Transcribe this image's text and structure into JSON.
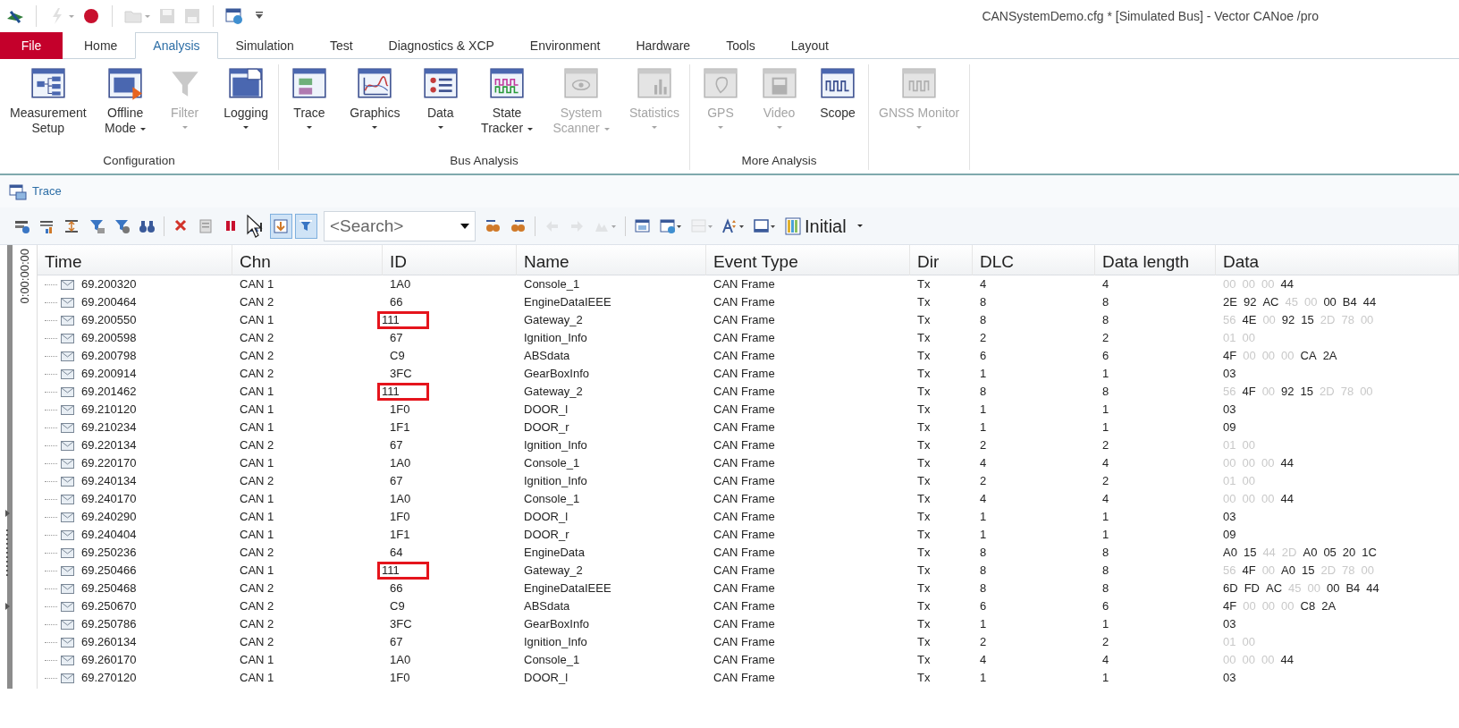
{
  "window": {
    "title": "CANSystemDemo.cfg * [Simulated Bus] - Vector CANoe /pro"
  },
  "quick_access": [
    {
      "kind": "logo",
      "disabled": false
    },
    {
      "kind": "sep"
    },
    {
      "kind": "bolt",
      "disabled": true,
      "dropdown": true
    },
    {
      "kind": "stop",
      "disabled": false
    },
    {
      "kind": "sep"
    },
    {
      "kind": "folder",
      "disabled": true,
      "dropdown": true
    },
    {
      "kind": "save",
      "disabled": true
    },
    {
      "kind": "saveall",
      "disabled": true
    },
    {
      "kind": "sep"
    },
    {
      "kind": "globe",
      "disabled": false
    },
    {
      "kind": "customize",
      "disabled": false
    }
  ],
  "menu_tabs": [
    {
      "label": "File",
      "kind": "file",
      "selected": false
    },
    {
      "label": "Home",
      "kind": "tab",
      "selected": false
    },
    {
      "label": "Analysis",
      "kind": "tab",
      "selected": true
    },
    {
      "label": "Simulation",
      "kind": "tab",
      "selected": false
    },
    {
      "label": "Test",
      "kind": "tab",
      "selected": false
    },
    {
      "label": "Diagnostics & XCP",
      "kind": "tab",
      "selected": false
    },
    {
      "label": "Environment",
      "kind": "tab",
      "selected": false
    },
    {
      "label": "Hardware",
      "kind": "tab",
      "selected": false
    },
    {
      "label": "Tools",
      "kind": "tab",
      "selected": false
    },
    {
      "label": "Layout",
      "kind": "tab",
      "selected": false
    }
  ],
  "ribbon_groups": [
    {
      "label": "Configuration",
      "buttons": [
        {
          "kind": "measurement",
          "lines": [
            "Measurement",
            "Setup"
          ],
          "dropdown": false,
          "disabled": false
        },
        {
          "kind": "offline",
          "lines": [
            "Offline",
            "Mode"
          ],
          "dropdown": true,
          "disabled": false
        },
        {
          "kind": "filter",
          "lines": [
            "Filter"
          ],
          "dropdown": true,
          "disabled": true
        },
        {
          "kind": "logging",
          "lines": [
            "Logging"
          ],
          "dropdown": true,
          "disabled": false
        }
      ]
    },
    {
      "label": "Bus Analysis",
      "buttons": [
        {
          "kind": "trace",
          "lines": [
            "Trace"
          ],
          "dropdown": true,
          "disabled": false
        },
        {
          "kind": "graphics",
          "lines": [
            "Graphics"
          ],
          "dropdown": true,
          "disabled": false
        },
        {
          "kind": "data",
          "lines": [
            "Data"
          ],
          "dropdown": true,
          "disabled": false
        },
        {
          "kind": "state",
          "lines": [
            "State",
            "Tracker"
          ],
          "dropdown": true,
          "disabled": false
        },
        {
          "kind": "scanner",
          "lines": [
            "System",
            "Scanner"
          ],
          "dropdown": true,
          "disabled": true
        },
        {
          "kind": "statistics",
          "lines": [
            "Statistics"
          ],
          "dropdown": true,
          "disabled": true
        }
      ]
    },
    {
      "label": "More Analysis",
      "buttons": [
        {
          "kind": "gps",
          "lines": [
            "GPS"
          ],
          "dropdown": true,
          "disabled": true
        },
        {
          "kind": "video",
          "lines": [
            "Video"
          ],
          "dropdown": true,
          "disabled": true
        },
        {
          "kind": "scope",
          "lines": [
            "Scope"
          ],
          "dropdown": false,
          "disabled": false
        }
      ]
    },
    {
      "buttons": [
        {
          "kind": "gnss",
          "lines": [
            "GNSS Monitor"
          ],
          "dropdown": true,
          "disabled": true
        }
      ]
    }
  ],
  "panel_tab": {
    "label": "Trace"
  },
  "toolbar": {
    "items": [
      {
        "kind": "config",
        "selected": false,
        "disabled": false
      },
      {
        "kind": "bars",
        "selected": false,
        "disabled": false
      },
      {
        "kind": "sort",
        "selected": false,
        "disabled": false
      },
      {
        "kind": "funnel",
        "selected": false,
        "disabled": false
      },
      {
        "kind": "funnel2",
        "selected": false,
        "disabled": false
      },
      {
        "kind": "binoculars",
        "selected": false,
        "disabled": false
      },
      {
        "kind": "sep"
      },
      {
        "kind": "delete",
        "selected": false,
        "disabled": false
      },
      {
        "kind": "clear",
        "selected": false,
        "disabled": false
      },
      {
        "kind": "pause",
        "selected": false,
        "disabled": false
      },
      {
        "kind": "marker",
        "selected": false,
        "disabled": false
      },
      {
        "kind": "autoscroll",
        "selected": true,
        "disabled": false
      },
      {
        "kind": "viewfilter",
        "selected": true,
        "disabled": false
      },
      {
        "kind": "search"
      },
      {
        "kind": "findprev",
        "selected": false,
        "disabled": false
      },
      {
        "kind": "findnext",
        "selected": false,
        "disabled": false
      },
      {
        "kind": "sep"
      },
      {
        "kind": "back",
        "selected": false,
        "disabled": true
      },
      {
        "kind": "forward",
        "selected": false,
        "disabled": true
      },
      {
        "kind": "bookmark",
        "selected": false,
        "disabled": true,
        "dropdown": true
      },
      {
        "kind": "sep"
      },
      {
        "kind": "window",
        "selected": false,
        "disabled": false
      },
      {
        "kind": "windowglobe",
        "selected": false,
        "disabled": false,
        "dropdown": true
      },
      {
        "kind": "columns",
        "selected": false,
        "disabled": true,
        "dropdown": true
      },
      {
        "kind": "font",
        "selected": false,
        "disabled": false,
        "dropdown": true
      },
      {
        "kind": "frame",
        "selected": false,
        "disabled": false,
        "dropdown": true
      },
      {
        "kind": "layout"
      }
    ],
    "search": {
      "placeholder": "<Search>"
    },
    "layout": {
      "value": "Initial"
    }
  },
  "time_axis": {
    "label": "0:00:00:00"
  },
  "table": {
    "columns": [
      "Time",
      "Chn",
      "ID",
      "Name",
      "Event Type",
      "Dir",
      "DLC",
      "Data length",
      "Data"
    ],
    "rows": [
      {
        "time": "69.200320",
        "chn": "CAN 1",
        "id": "1A0",
        "name": "Console_1",
        "event_type": "CAN Frame",
        "dir": "Tx",
        "dlc": "4",
        "data_length": "4",
        "marked": false,
        "data": [
          {
            "byte": "00",
            "faded": true
          },
          {
            "byte": "00",
            "faded": true
          },
          {
            "byte": "00",
            "faded": true
          },
          {
            "byte": "44",
            "faded": false
          }
        ]
      },
      {
        "time": "69.200464",
        "chn": "CAN 2",
        "id": "66",
        "name": "EngineDataIEEE",
        "event_type": "CAN Frame",
        "dir": "Tx",
        "dlc": "8",
        "data_length": "8",
        "marked": false,
        "data": [
          {
            "byte": "2E",
            "faded": false
          },
          {
            "byte": "92",
            "faded": false
          },
          {
            "byte": "AC",
            "faded": false
          },
          {
            "byte": "45",
            "faded": true
          },
          {
            "byte": "00",
            "faded": true
          },
          {
            "byte": "00",
            "faded": false
          },
          {
            "byte": "B4",
            "faded": false
          },
          {
            "byte": "44",
            "faded": false
          }
        ]
      },
      {
        "time": "69.200550",
        "chn": "CAN 1",
        "id": "111",
        "name": "Gateway_2",
        "event_type": "CAN Frame",
        "dir": "Tx",
        "dlc": "8",
        "data_length": "8",
        "marked": true,
        "data": [
          {
            "byte": "56",
            "faded": true
          },
          {
            "byte": "4E",
            "faded": false
          },
          {
            "byte": "00",
            "faded": true
          },
          {
            "byte": "92",
            "faded": false
          },
          {
            "byte": "15",
            "faded": false
          },
          {
            "byte": "2D",
            "faded": true
          },
          {
            "byte": "78",
            "faded": true
          },
          {
            "byte": "00",
            "faded": true
          }
        ]
      },
      {
        "time": "69.200598",
        "chn": "CAN 2",
        "id": "67",
        "name": "Ignition_Info",
        "event_type": "CAN Frame",
        "dir": "Tx",
        "dlc": "2",
        "data_length": "2",
        "marked": false,
        "data": [
          {
            "byte": "01",
            "faded": true
          },
          {
            "byte": "00",
            "faded": true
          }
        ]
      },
      {
        "time": "69.200798",
        "chn": "CAN 2",
        "id": "C9",
        "name": "ABSdata",
        "event_type": "CAN Frame",
        "dir": "Tx",
        "dlc": "6",
        "data_length": "6",
        "marked": false,
        "data": [
          {
            "byte": "4F",
            "faded": false
          },
          {
            "byte": "00",
            "faded": true
          },
          {
            "byte": "00",
            "faded": true
          },
          {
            "byte": "00",
            "faded": true
          },
          {
            "byte": "CA",
            "faded": false
          },
          {
            "byte": "2A",
            "faded": false
          }
        ]
      },
      {
        "time": "69.200914",
        "chn": "CAN 2",
        "id": "3FC",
        "name": "GearBoxInfo",
        "event_type": "CAN Frame",
        "dir": "Tx",
        "dlc": "1",
        "data_length": "1",
        "marked": false,
        "data": [
          {
            "byte": "03",
            "faded": false
          }
        ]
      },
      {
        "time": "69.201462",
        "chn": "CAN 1",
        "id": "111",
        "name": "Gateway_2",
        "event_type": "CAN Frame",
        "dir": "Tx",
        "dlc": "8",
        "data_length": "8",
        "marked": true,
        "data": [
          {
            "byte": "56",
            "faded": true
          },
          {
            "byte": "4F",
            "faded": false
          },
          {
            "byte": "00",
            "faded": true
          },
          {
            "byte": "92",
            "faded": false
          },
          {
            "byte": "15",
            "faded": false
          },
          {
            "byte": "2D",
            "faded": true
          },
          {
            "byte": "78",
            "faded": true
          },
          {
            "byte": "00",
            "faded": true
          }
        ]
      },
      {
        "time": "69.210120",
        "chn": "CAN 1",
        "id": "1F0",
        "name": "DOOR_l",
        "event_type": "CAN Frame",
        "dir": "Tx",
        "dlc": "1",
        "data_length": "1",
        "marked": false,
        "data": [
          {
            "byte": "03",
            "faded": false
          }
        ]
      },
      {
        "time": "69.210234",
        "chn": "CAN 1",
        "id": "1F1",
        "name": "DOOR_r",
        "event_type": "CAN Frame",
        "dir": "Tx",
        "dlc": "1",
        "data_length": "1",
        "marked": false,
        "data": [
          {
            "byte": "09",
            "faded": false
          }
        ]
      },
      {
        "time": "69.220134",
        "chn": "CAN 2",
        "id": "67",
        "name": "Ignition_Info",
        "event_type": "CAN Frame",
        "dir": "Tx",
        "dlc": "2",
        "data_length": "2",
        "marked": false,
        "data": [
          {
            "byte": "01",
            "faded": true
          },
          {
            "byte": "00",
            "faded": true
          }
        ]
      },
      {
        "time": "69.220170",
        "chn": "CAN 1",
        "id": "1A0",
        "name": "Console_1",
        "event_type": "CAN Frame",
        "dir": "Tx",
        "dlc": "4",
        "data_length": "4",
        "marked": false,
        "data": [
          {
            "byte": "00",
            "faded": true
          },
          {
            "byte": "00",
            "faded": true
          },
          {
            "byte": "00",
            "faded": true
          },
          {
            "byte": "44",
            "faded": false
          }
        ]
      },
      {
        "time": "69.240134",
        "chn": "CAN 2",
        "id": "67",
        "name": "Ignition_Info",
        "event_type": "CAN Frame",
        "dir": "Tx",
        "dlc": "2",
        "data_length": "2",
        "marked": false,
        "data": [
          {
            "byte": "01",
            "faded": true
          },
          {
            "byte": "00",
            "faded": true
          }
        ]
      },
      {
        "time": "69.240170",
        "chn": "CAN 1",
        "id": "1A0",
        "name": "Console_1",
        "event_type": "CAN Frame",
        "dir": "Tx",
        "dlc": "4",
        "data_length": "4",
        "marked": false,
        "data": [
          {
            "byte": "00",
            "faded": true
          },
          {
            "byte": "00",
            "faded": true
          },
          {
            "byte": "00",
            "faded": true
          },
          {
            "byte": "44",
            "faded": false
          }
        ]
      },
      {
        "time": "69.240290",
        "chn": "CAN 1",
        "id": "1F0",
        "name": "DOOR_l",
        "event_type": "CAN Frame",
        "dir": "Tx",
        "dlc": "1",
        "data_length": "1",
        "marked": false,
        "data": [
          {
            "byte": "03",
            "faded": false
          }
        ]
      },
      {
        "time": "69.240404",
        "chn": "CAN 1",
        "id": "1F1",
        "name": "DOOR_r",
        "event_type": "CAN Frame",
        "dir": "Tx",
        "dlc": "1",
        "data_length": "1",
        "marked": false,
        "data": [
          {
            "byte": "09",
            "faded": false
          }
        ]
      },
      {
        "time": "69.250236",
        "chn": "CAN 2",
        "id": "64",
        "name": "EngineData",
        "event_type": "CAN Frame",
        "dir": "Tx",
        "dlc": "8",
        "data_length": "8",
        "marked": false,
        "data": [
          {
            "byte": "A0",
            "faded": false
          },
          {
            "byte": "15",
            "faded": false
          },
          {
            "byte": "44",
            "faded": true
          },
          {
            "byte": "2D",
            "faded": true
          },
          {
            "byte": "A0",
            "faded": false
          },
          {
            "byte": "05",
            "faded": false
          },
          {
            "byte": "20",
            "faded": false
          },
          {
            "byte": "1C",
            "faded": false
          }
        ]
      },
      {
        "time": "69.250466",
        "chn": "CAN 1",
        "id": "111",
        "name": "Gateway_2",
        "event_type": "CAN Frame",
        "dir": "Tx",
        "dlc": "8",
        "data_length": "8",
        "marked": true,
        "data": [
          {
            "byte": "56",
            "faded": true
          },
          {
            "byte": "4F",
            "faded": false
          },
          {
            "byte": "00",
            "faded": true
          },
          {
            "byte": "A0",
            "faded": false
          },
          {
            "byte": "15",
            "faded": false
          },
          {
            "byte": "2D",
            "faded": true
          },
          {
            "byte": "78",
            "faded": true
          },
          {
            "byte": "00",
            "faded": true
          }
        ]
      },
      {
        "time": "69.250468",
        "chn": "CAN 2",
        "id": "66",
        "name": "EngineDataIEEE",
        "event_type": "CAN Frame",
        "dir": "Tx",
        "dlc": "8",
        "data_length": "8",
        "marked": false,
        "data": [
          {
            "byte": "6D",
            "faded": false
          },
          {
            "byte": "FD",
            "faded": false
          },
          {
            "byte": "AC",
            "faded": false
          },
          {
            "byte": "45",
            "faded": true
          },
          {
            "byte": "00",
            "faded": true
          },
          {
            "byte": "00",
            "faded": false
          },
          {
            "byte": "B4",
            "faded": false
          },
          {
            "byte": "44",
            "faded": false
          }
        ]
      },
      {
        "time": "69.250670",
        "chn": "CAN 2",
        "id": "C9",
        "name": "ABSdata",
        "event_type": "CAN Frame",
        "dir": "Tx",
        "dlc": "6",
        "data_length": "6",
        "marked": false,
        "data": [
          {
            "byte": "4F",
            "faded": false
          },
          {
            "byte": "00",
            "faded": true
          },
          {
            "byte": "00",
            "faded": true
          },
          {
            "byte": "00",
            "faded": true
          },
          {
            "byte": "C8",
            "faded": false
          },
          {
            "byte": "2A",
            "faded": false
          }
        ]
      },
      {
        "time": "69.250786",
        "chn": "CAN 2",
        "id": "3FC",
        "name": "GearBoxInfo",
        "event_type": "CAN Frame",
        "dir": "Tx",
        "dlc": "1",
        "data_length": "1",
        "marked": false,
        "data": [
          {
            "byte": "03",
            "faded": false
          }
        ]
      },
      {
        "time": "69.260134",
        "chn": "CAN 2",
        "id": "67",
        "name": "Ignition_Info",
        "event_type": "CAN Frame",
        "dir": "Tx",
        "dlc": "2",
        "data_length": "2",
        "marked": false,
        "data": [
          {
            "byte": "01",
            "faded": true
          },
          {
            "byte": "00",
            "faded": true
          }
        ]
      },
      {
        "time": "69.260170",
        "chn": "CAN 1",
        "id": "1A0",
        "name": "Console_1",
        "event_type": "CAN Frame",
        "dir": "Tx",
        "dlc": "4",
        "data_length": "4",
        "marked": false,
        "data": [
          {
            "byte": "00",
            "faded": true
          },
          {
            "byte": "00",
            "faded": true
          },
          {
            "byte": "00",
            "faded": true
          },
          {
            "byte": "44",
            "faded": false
          }
        ]
      },
      {
        "time": "69.270120",
        "chn": "CAN 1",
        "id": "1F0",
        "name": "DOOR_l",
        "event_type": "CAN Frame",
        "dir": "Tx",
        "dlc": "1",
        "data_length": "1",
        "marked": false,
        "data": [
          {
            "byte": "03",
            "faded": false
          }
        ]
      }
    ]
  }
}
